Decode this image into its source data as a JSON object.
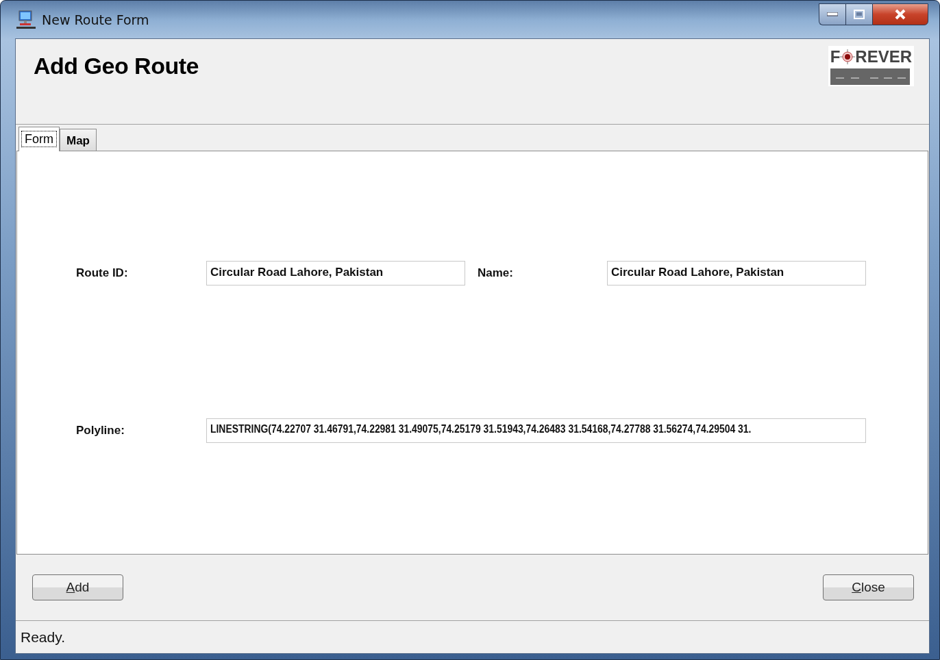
{
  "window": {
    "title": "New Route Form"
  },
  "header": {
    "title": "Add Geo Route",
    "logo": {
      "left": "F",
      "right": "REVER"
    }
  },
  "tabs": [
    {
      "label": "Form",
      "selected": true
    },
    {
      "label": "Map",
      "selected": false
    }
  ],
  "form": {
    "route_id": {
      "label": "Route ID:",
      "value": "Circular Road Lahore, Pakistan"
    },
    "name": {
      "label": "Name:",
      "value": "Circular Road Lahore, Pakistan"
    },
    "polyline": {
      "label": "Polyline:",
      "value": "LINESTRING(74.22707 31.46791,74.22981 31.49075,74.25179 31.51943,74.26483 31.54168,74.27788 31.56274,74.29504 31."
    }
  },
  "buttons": [
    {
      "label": "Add",
      "mnemonic": true
    },
    {
      "label": "Close",
      "mnemonic": true
    }
  ],
  "status_bar": "Ready."
}
